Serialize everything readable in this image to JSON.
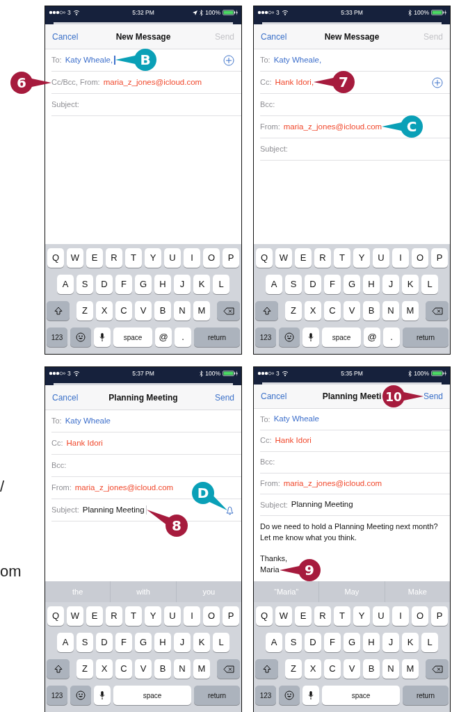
{
  "margin_text": [
    "/",
    "om"
  ],
  "phones": [
    {
      "status": {
        "carrier": "3",
        "time": "5:32 PM",
        "location": true,
        "battery": "100%"
      },
      "nav": {
        "cancel": "Cancel",
        "title": "New Message",
        "send": {
          "label": "Send",
          "disabled": true
        }
      },
      "fields": [
        {
          "label": "To:",
          "value": "Katy Wheale,",
          "color": "#3d6fcb",
          "cursor": true,
          "add_button": true,
          "value_callouts": [
            {
              "label": "B",
              "kind": "tip"
            }
          ]
        },
        {
          "label": "Cc/Bcc, From:",
          "value": "maria_z_jones@icloud.com",
          "color": "#f0482c",
          "label_callouts": [
            {
              "label": "6",
              "kind": "step"
            }
          ]
        },
        {
          "label": "Subject:"
        }
      ],
      "keyboard": {
        "rows": [
          [
            "Q",
            "W",
            "E",
            "R",
            "T",
            "Y",
            "U",
            "I",
            "O",
            "P"
          ],
          [
            "A",
            "S",
            "D",
            "F",
            "G",
            "H",
            "J",
            "K",
            "L"
          ],
          [
            "Z",
            "X",
            "C",
            "V",
            "B",
            "N",
            "M"
          ]
        ],
        "bottom": [
          {
            "kind": "function",
            "label": "123"
          },
          {
            "kind": "emoji"
          },
          {
            "kind": "mic"
          },
          {
            "kind": "space",
            "label": "space"
          },
          {
            "kind": "letter",
            "label": "@"
          },
          {
            "kind": "letter",
            "label": "."
          },
          {
            "kind": "return",
            "label": "return"
          }
        ]
      }
    },
    {
      "status": {
        "carrier": "3",
        "time": "5:33 PM",
        "location": false,
        "battery": "100%"
      },
      "nav": {
        "cancel": "Cancel",
        "title": "New Message",
        "send": {
          "label": "Send",
          "disabled": true
        }
      },
      "fields": [
        {
          "label": "To:",
          "value": "Katy Wheale,",
          "color": "#3d6fcb"
        },
        {
          "label": "Cc:",
          "value": "Hank Idori,",
          "color": "#f0482c",
          "add_button": true,
          "value_callouts": [
            {
              "label": "7",
              "kind": "step"
            }
          ]
        },
        {
          "label": "Bcc:"
        },
        {
          "label": "From:",
          "value": "maria_z_jones@icloud.com",
          "color": "#f0482c",
          "value_callouts": [
            {
              "label": "C",
              "kind": "tip"
            }
          ]
        },
        {
          "label": "Subject:"
        }
      ],
      "keyboard": {
        "rows": [
          [
            "Q",
            "W",
            "E",
            "R",
            "T",
            "Y",
            "U",
            "I",
            "O",
            "P"
          ],
          [
            "A",
            "S",
            "D",
            "F",
            "G",
            "H",
            "J",
            "K",
            "L"
          ],
          [
            "Z",
            "X",
            "C",
            "V",
            "B",
            "N",
            "M"
          ]
        ],
        "bottom": [
          {
            "kind": "function",
            "label": "123"
          },
          {
            "kind": "emoji"
          },
          {
            "kind": "mic"
          },
          {
            "kind": "space",
            "label": "space"
          },
          {
            "kind": "letter",
            "label": "@"
          },
          {
            "kind": "letter",
            "label": "."
          },
          {
            "kind": "return",
            "label": "return"
          }
        ]
      }
    },
    {
      "status": {
        "carrier": "3",
        "time": "5:37 PM",
        "location": false,
        "battery": "100%"
      },
      "nav": {
        "cancel": "Cancel",
        "title": "Planning Meeting",
        "send": {
          "label": "Send",
          "disabled": false
        }
      },
      "fields": [
        {
          "label": "To:",
          "value": "Katy Wheale",
          "color": "#3d6fcb"
        },
        {
          "label": "Cc:",
          "value": "Hank Idori",
          "color": "#f0482c"
        },
        {
          "label": "Bcc:"
        },
        {
          "label": "From:",
          "value": "maria_z_jones@icloud.com",
          "color": "#f0482c"
        },
        {
          "label": "Subject:",
          "value": "Planning Meeting",
          "cursor": true,
          "bell": true,
          "value_callouts": [
            {
              "label": "8",
              "kind": "step"
            }
          ],
          "bell_callouts": [
            {
              "label": "D",
              "kind": "tip"
            }
          ]
        }
      ],
      "suggestions": [
        "the",
        "with",
        "you"
      ],
      "keyboard": {
        "rows": [
          [
            "Q",
            "W",
            "E",
            "R",
            "T",
            "Y",
            "U",
            "I",
            "O",
            "P"
          ],
          [
            "A",
            "S",
            "D",
            "F",
            "G",
            "H",
            "J",
            "K",
            "L"
          ],
          [
            "Z",
            "X",
            "C",
            "V",
            "B",
            "N",
            "M"
          ]
        ],
        "bottom": [
          {
            "kind": "function",
            "label": "123"
          },
          {
            "kind": "emoji"
          },
          {
            "kind": "mic"
          },
          {
            "kind": "space",
            "label": "space"
          },
          {
            "kind": "return",
            "label": "return"
          }
        ]
      }
    },
    {
      "status": {
        "carrier": "3",
        "time": "5:35 PM",
        "location": false,
        "battery": "100%"
      },
      "nav": {
        "cancel": "Cancel",
        "title": "Planning Meeti",
        "send": {
          "label": "Send",
          "disabled": false,
          "callouts": [
            {
              "label": "10",
              "kind": "step"
            }
          ]
        }
      },
      "fields": [
        {
          "label": "To:",
          "value": "Katy Wheale",
          "color": "#3d6fcb"
        },
        {
          "label": "Cc:",
          "value": "Hank Idori",
          "color": "#f0482c"
        },
        {
          "label": "Bcc:"
        },
        {
          "label": "From:",
          "value": "maria_z_jones@icloud.com",
          "color": "#f0482c"
        },
        {
          "label": "Subject:",
          "value": "Planning Meeting"
        }
      ],
      "body": [
        {
          "kind": "paragraph",
          "text": "Do we need to hold a Planning Meeting next month? Let me know what you think."
        },
        {
          "kind": "line",
          "text": "Thanks,"
        },
        {
          "kind": "line",
          "text": "Maria",
          "callouts": [
            {
              "label": "9",
              "kind": "step"
            }
          ]
        }
      ],
      "suggestions": [
        "“Maria”",
        "May",
        "Make"
      ],
      "keyboard": {
        "rows": [
          [
            "Q",
            "W",
            "E",
            "R",
            "T",
            "Y",
            "U",
            "I",
            "O",
            "P"
          ],
          [
            "A",
            "S",
            "D",
            "F",
            "G",
            "H",
            "J",
            "K",
            "L"
          ],
          [
            "Z",
            "X",
            "C",
            "V",
            "B",
            "N",
            "M"
          ]
        ],
        "bottom": [
          {
            "kind": "function",
            "label": "123"
          },
          {
            "kind": "emoji"
          },
          {
            "kind": "mic"
          },
          {
            "kind": "space",
            "label": "space"
          },
          {
            "kind": "return",
            "label": "return"
          }
        ]
      }
    }
  ]
}
